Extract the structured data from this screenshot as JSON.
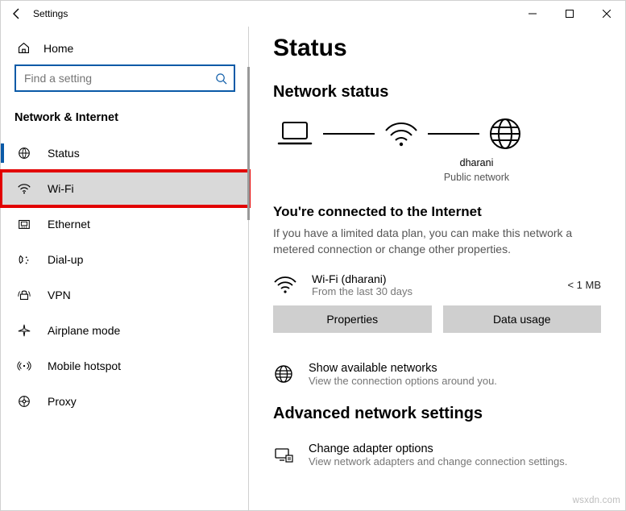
{
  "window": {
    "title": "Settings"
  },
  "sidebar": {
    "home": "Home",
    "search_placeholder": "Find a setting",
    "category": "Network & Internet",
    "items": [
      {
        "label": "Status",
        "icon": "status-icon",
        "active": true,
        "highlight": false
      },
      {
        "label": "Wi-Fi",
        "icon": "wifi-icon",
        "active": false,
        "highlight": true
      },
      {
        "label": "Ethernet",
        "icon": "ethernet-icon",
        "active": false,
        "highlight": false
      },
      {
        "label": "Dial-up",
        "icon": "dialup-icon",
        "active": false,
        "highlight": false
      },
      {
        "label": "VPN",
        "icon": "vpn-icon",
        "active": false,
        "highlight": false
      },
      {
        "label": "Airplane mode",
        "icon": "airplane-icon",
        "active": false,
        "highlight": false
      },
      {
        "label": "Mobile hotspot",
        "icon": "hotspot-icon",
        "active": false,
        "highlight": false
      },
      {
        "label": "Proxy",
        "icon": "proxy-icon",
        "active": false,
        "highlight": false
      }
    ]
  },
  "content": {
    "title": "Status",
    "section_title": "Network status",
    "diagram": {
      "name": "dharani",
      "subtitle": "Public network"
    },
    "connected_heading": "You're connected to the Internet",
    "connected_desc": "If you have a limited data plan, you can make this network a metered connection or change other properties.",
    "connection": {
      "name": "Wi-Fi (dharani)",
      "sub": "From the last 30 days",
      "usage": "< 1 MB"
    },
    "buttons": {
      "properties": "Properties",
      "data_usage": "Data usage"
    },
    "available": {
      "title": "Show available networks",
      "sub": "View the connection options around you."
    },
    "advanced_heading": "Advanced network settings",
    "adapter": {
      "title": "Change adapter options",
      "sub": "View network adapters and change connection settings."
    }
  },
  "watermark": "wsxdn.com"
}
